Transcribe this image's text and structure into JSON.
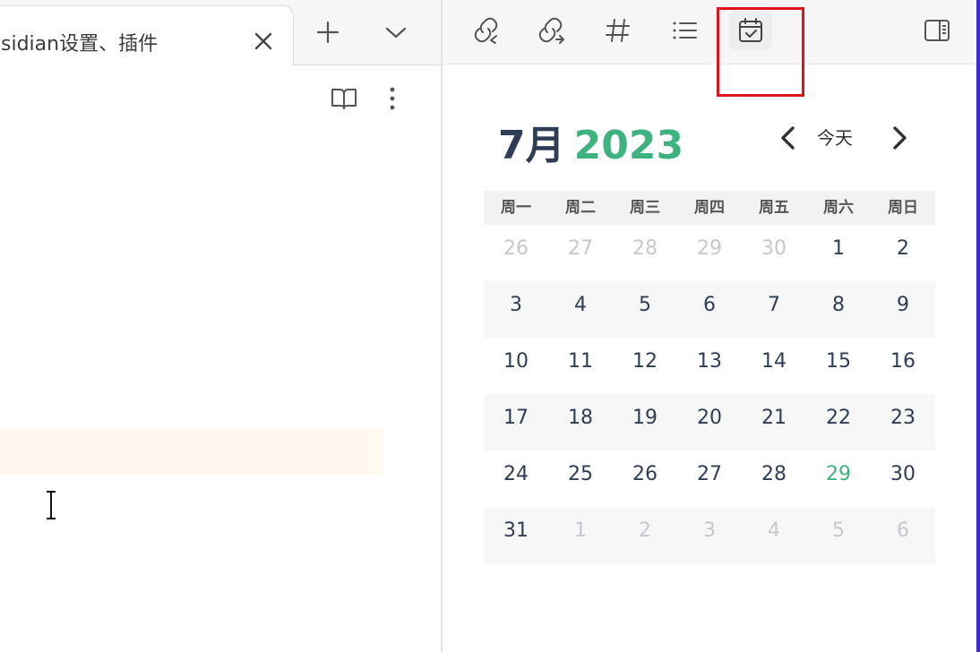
{
  "tab": {
    "title": "sidian设置、插件"
  },
  "calendar": {
    "month_label": "7月",
    "year_label": "2023",
    "today_label": "今天",
    "weekdays": [
      "周一",
      "周二",
      "周三",
      "周四",
      "周五",
      "周六",
      "周日"
    ],
    "weeks": [
      [
        "26",
        "27",
        "28",
        "29",
        "30",
        "1",
        "2"
      ],
      [
        "3",
        "4",
        "5",
        "6",
        "7",
        "8",
        "9"
      ],
      [
        "10",
        "11",
        "12",
        "13",
        "14",
        "15",
        "16"
      ],
      [
        "17",
        "18",
        "19",
        "20",
        "21",
        "22",
        "23"
      ],
      [
        "24",
        "25",
        "26",
        "27",
        "28",
        "29",
        "30"
      ],
      [
        "31",
        "1",
        "2",
        "3",
        "4",
        "5",
        "6"
      ]
    ],
    "outside_month": [
      [
        0,
        0
      ],
      [
        0,
        1
      ],
      [
        0,
        2
      ],
      [
        0,
        3
      ],
      [
        0,
        4
      ],
      [
        5,
        1
      ],
      [
        5,
        2
      ],
      [
        5,
        3
      ],
      [
        5,
        4
      ],
      [
        5,
        5
      ],
      [
        5,
        6
      ]
    ],
    "today_cell": [
      4,
      5
    ]
  },
  "toolbar": {
    "icons": [
      "backlinks-icon",
      "outgoing-links-icon",
      "tags-icon",
      "outline-icon",
      "calendar-icon"
    ],
    "active": "calendar-icon"
  },
  "colors": {
    "accent": "#3fb37f",
    "month_text": "#2f3e55",
    "annotation": "#e0131b",
    "window_edge": "#3f2ad1"
  }
}
